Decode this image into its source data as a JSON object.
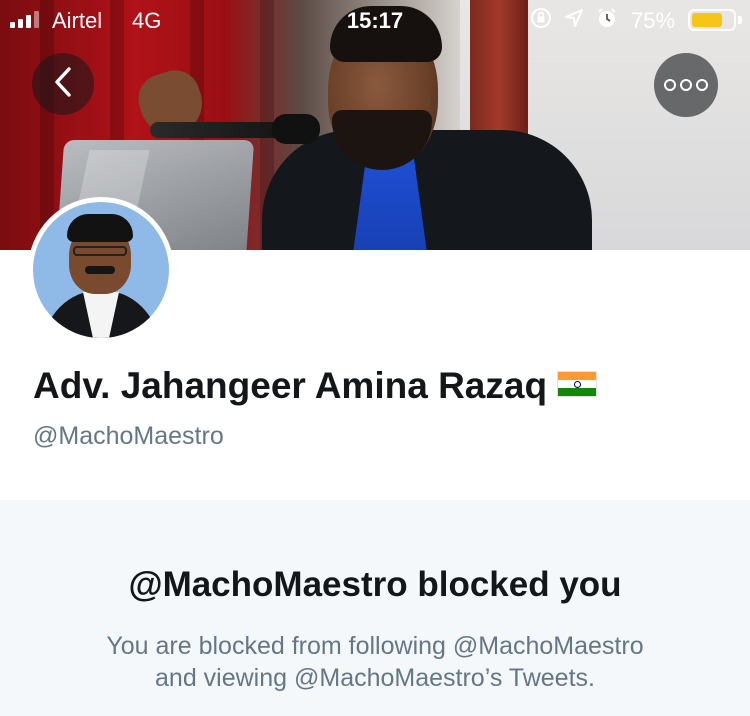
{
  "status_bar": {
    "carrier": "Airtel",
    "network": "4G",
    "time": "15:17",
    "battery_percent": "75%",
    "battery_level": 0.75,
    "icons": [
      "orientation-lock-icon",
      "location-arrow-icon",
      "alarm-icon"
    ]
  },
  "header": {
    "back_icon": "chevron-left-icon",
    "more_icon": "more-options-icon"
  },
  "profile": {
    "display_name": "Adv. Jahangeer Amina Razaq",
    "flag_icon": "india-flag-icon",
    "handle": "@MachoMaestro"
  },
  "blocked": {
    "title": "@MachoMaestro blocked you",
    "line1": "You are blocked from following @MachoMaestro",
    "line2": "and viewing @MachoMaestro’s Tweets."
  },
  "colors": {
    "primary_text": "#14171a",
    "secondary_text": "#657786",
    "panel_background": "#f5f8fa",
    "battery_fill": "#f5c518"
  }
}
